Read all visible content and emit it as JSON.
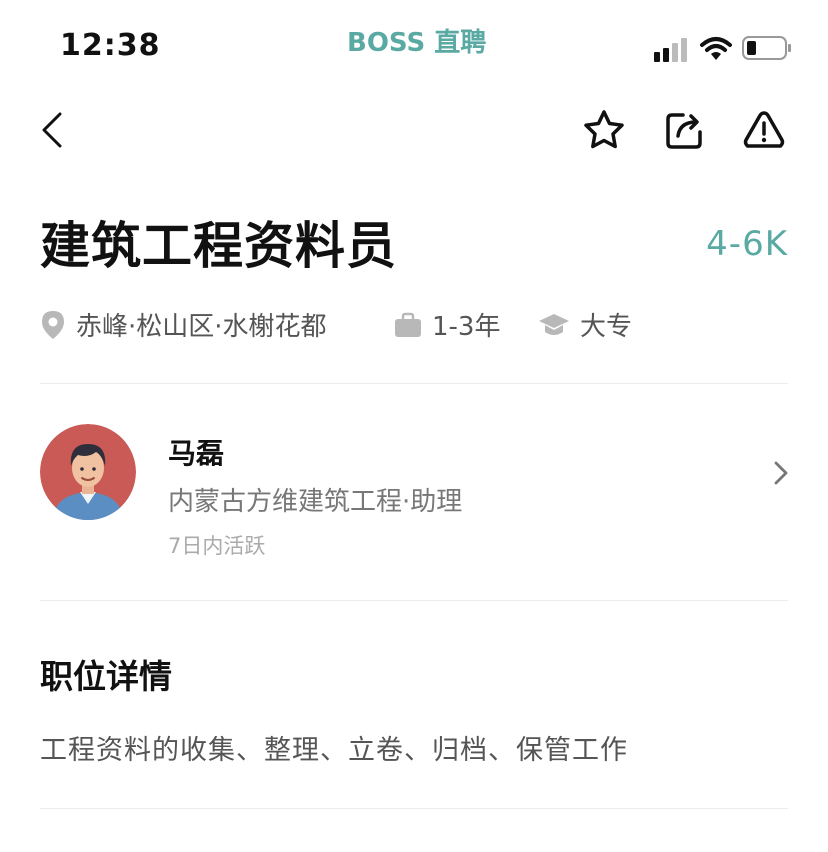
{
  "status_bar": {
    "time": "12:38",
    "carrier": "BOSS 直聘"
  },
  "toolbar": {
    "back_icon": "chevron-left-icon",
    "favorite_icon": "star-outline-icon",
    "share_icon": "share-icon",
    "report_icon": "warning-icon"
  },
  "job": {
    "title": "建筑工程资料员",
    "salary": "4-6K",
    "location": "赤峰·松山区·水榭花都",
    "experience": "1-3年",
    "education": "大专"
  },
  "recruiter": {
    "name": "马磊",
    "company_role": "内蒙古方维建筑工程·助理",
    "active": "7日内活跃"
  },
  "details": {
    "section_title": "职位详情",
    "description": "工程资料的收集、整理、立卷、归档、保管工作"
  },
  "colors": {
    "accent": "#5aa9a3",
    "avatar_bg": "#c95a56"
  }
}
